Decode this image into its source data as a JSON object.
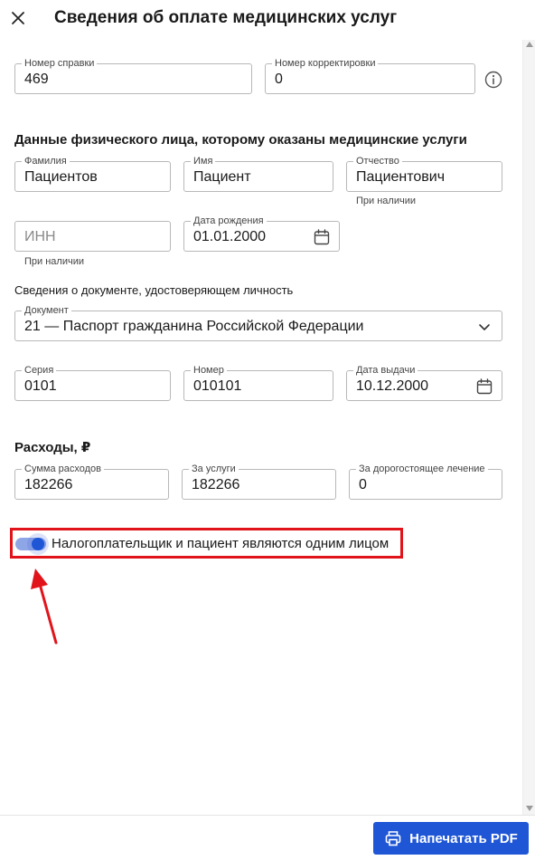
{
  "header": {
    "title": "Сведения об оплате медицинских услуг",
    "close_icon": "close-icon"
  },
  "certificate": {
    "number_label": "Номер справки",
    "number_value": "469",
    "correction_label": "Номер корректировки",
    "correction_value": "0",
    "info_icon": "info-icon"
  },
  "patient": {
    "section_title": "Данные физического лица, которому оказаны медицинские услуги",
    "surname_label": "Фамилия",
    "surname_value": "Пациентов",
    "name_label": "Имя",
    "name_value": "Пациент",
    "patronymic_label": "Отчество",
    "patronymic_value": "Пациентович",
    "patronymic_hint": "При наличии",
    "inn_placeholder": "ИНН",
    "inn_hint": "При наличии",
    "birth_label": "Дата рождения",
    "birth_value": "01.01.2000"
  },
  "document": {
    "section_text": "Сведения о документе, удостоверяющем личность",
    "type_label": "Документ",
    "type_value": "21 — Паспорт гражданина Российской Федерации",
    "series_label": "Серия",
    "series_value": "0101",
    "number_label": "Номер",
    "number_value": "010101",
    "issue_label": "Дата выдачи",
    "issue_value": "10.12.2000"
  },
  "expenses": {
    "section_title": "Расходы, ₽",
    "total_label": "Сумма расходов",
    "total_value": "182266",
    "services_label": "За услуги",
    "services_value": "182266",
    "expensive_label": "За дорогостоящее лечение",
    "expensive_value": "0"
  },
  "toggle": {
    "label": "Налогоплательщик и пациент являются одним лицом",
    "checked": true
  },
  "footer": {
    "print_label": "Напечатать PDF",
    "print_icon": "printer-icon"
  },
  "colors": {
    "accent": "#1f56d6",
    "highlight": "#e1141b",
    "border": "#b8b8b8"
  }
}
